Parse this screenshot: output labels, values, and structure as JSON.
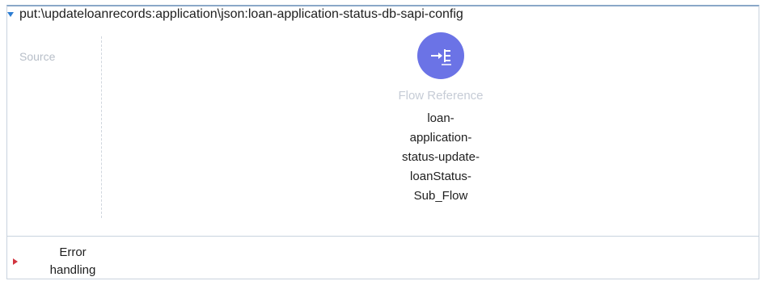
{
  "flow": {
    "title": "put:\\updateloanrecords:application\\json:loan-application-status-db-sapi-config",
    "source_label": "Source",
    "component": {
      "type_label": "Flow Reference",
      "name_lines": [
        "loan-",
        "application-",
        "status-update-",
        "loanStatus-",
        "Sub_Flow"
      ],
      "icon": "flow-reference-icon",
      "color": "#6b73e6"
    },
    "error_handling": {
      "label_lines": [
        "Error",
        "handling"
      ],
      "toggle_icon": "expand-triangle-icon",
      "toggle_color": "#d1343f"
    }
  }
}
